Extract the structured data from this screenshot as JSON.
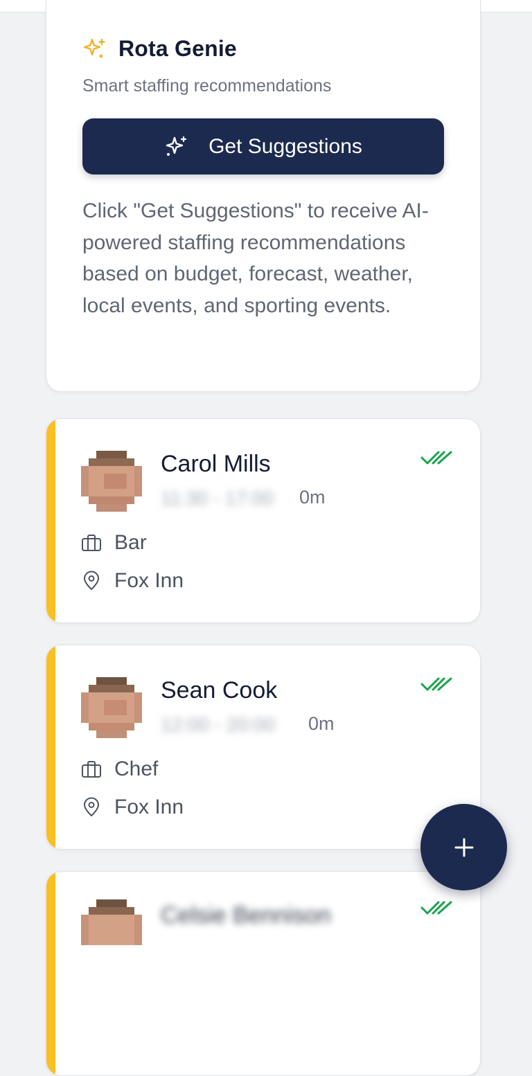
{
  "genie": {
    "title": "Rota Genie",
    "subtitle": "Smart staffing recommendations",
    "button_label": "Get Suggestions",
    "description": "Click \"Get Suggestions\" to receive AI-powered staffing recommendations based on budget, forecast, weather, local events, and sporting events."
  },
  "shifts": [
    {
      "name": "Carol Mills",
      "time": "11:30 - 17:00",
      "break": "0m",
      "role": "Bar",
      "location": "Fox Inn",
      "status": "confirmed"
    },
    {
      "name": "Sean Cook",
      "time": "12:00 - 20:00",
      "break": "0m",
      "role": "Chef",
      "location": "Fox Inn",
      "status": "confirmed"
    },
    {
      "name": "Celsie Bennison",
      "status": "confirmed"
    }
  ],
  "colors": {
    "navy": "#1c2a4f",
    "accent": "#fbbf24",
    "confirmed": "#16a34a"
  },
  "icons": {
    "genie": "sparkles-icon",
    "role": "briefcase-icon",
    "location": "map-pin-icon",
    "status": "double-check-icon",
    "fab": "plus-icon"
  }
}
